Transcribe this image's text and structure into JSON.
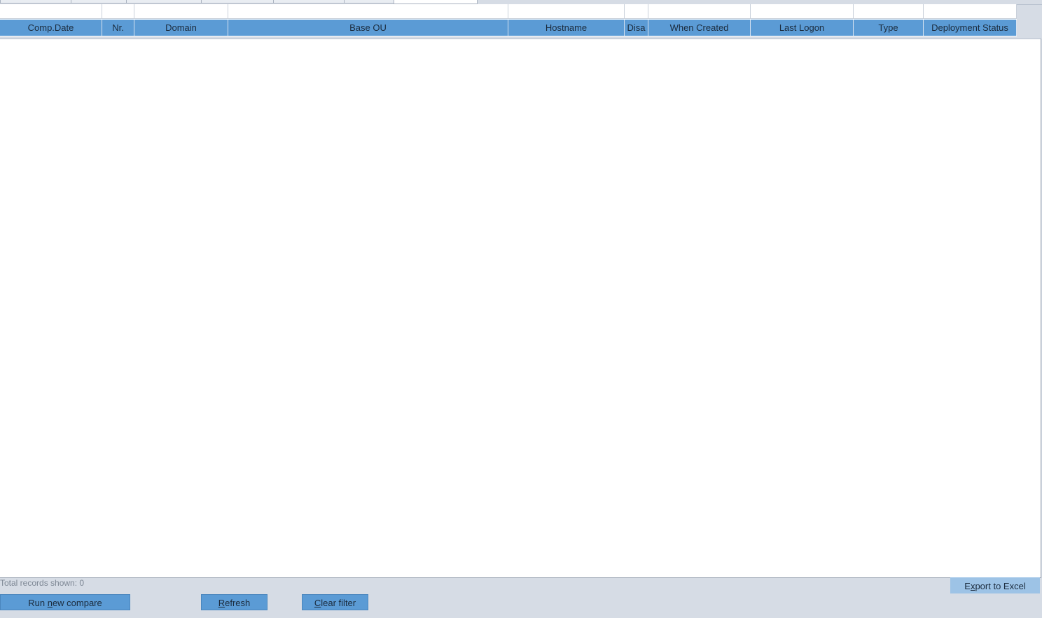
{
  "columns": [
    {
      "label": "Comp.Date"
    },
    {
      "label": "Nr."
    },
    {
      "label": "Domain"
    },
    {
      "label": "Base OU"
    },
    {
      "label": "Hostname"
    },
    {
      "label": "Disa"
    },
    {
      "label": "When Created"
    },
    {
      "label": "Last Logon"
    },
    {
      "label": "Type"
    },
    {
      "label": "Deployment Status"
    }
  ],
  "status": {
    "total_records": "Total records shown: 0"
  },
  "buttons": {
    "run_new_compare": {
      "before": "Run ",
      "accel": "n",
      "after": "ew compare"
    },
    "refresh": {
      "before": "",
      "accel": "R",
      "after": "efresh"
    },
    "clear_filter": {
      "before": "",
      "accel": "C",
      "after": "lear filter"
    },
    "export_to_excel": {
      "before": "E",
      "accel": "x",
      "after": "port to Excel"
    }
  },
  "colors": {
    "header_bg": "#5b9bd5",
    "button_bg": "#5b9bd5",
    "window_bg": "#d6dce5",
    "export_bg": "#9dc3e6"
  }
}
